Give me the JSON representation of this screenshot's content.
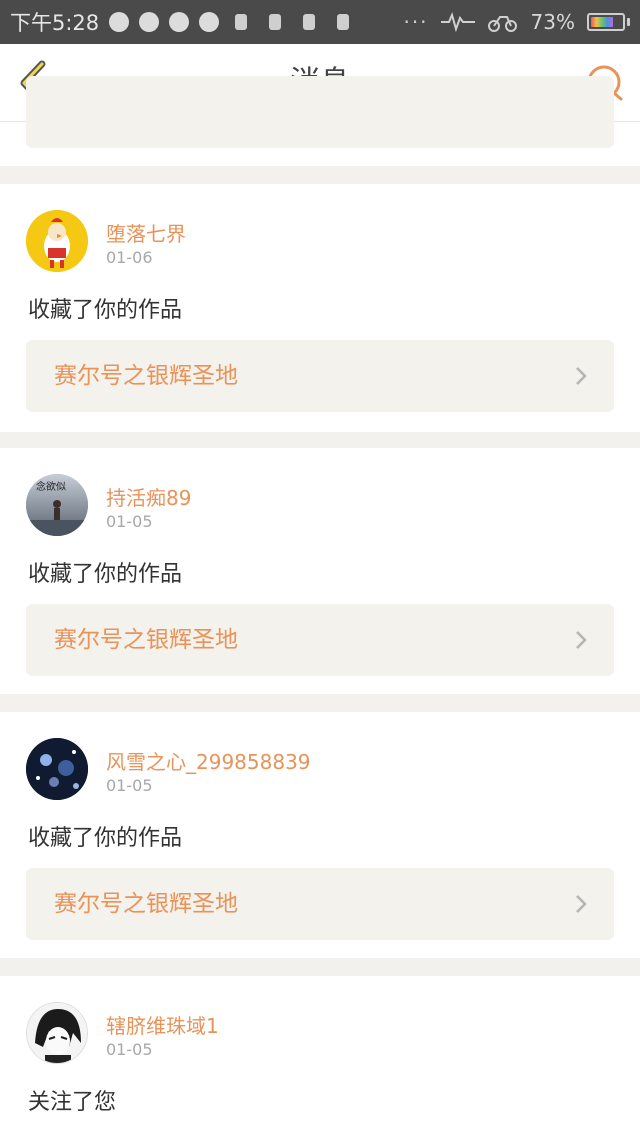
{
  "status_bar": {
    "time": "下午5:28",
    "dots": "···",
    "battery": "73%",
    "battery_level": 0.73
  },
  "header": {
    "title": "消息"
  },
  "messages": [
    {
      "username": "堕落七界",
      "date": "01-06",
      "action": "收藏了你的作品",
      "work_title": "赛尔号之银辉圣地"
    },
    {
      "username": "持活痴89",
      "date": "01-05",
      "action": "收藏了你的作品",
      "work_title": "赛尔号之银辉圣地",
      "avatar_text": "念欲似"
    },
    {
      "username": "风雪之心_299858839",
      "date": "01-05",
      "action": "收藏了你的作品",
      "work_title": "赛尔号之银辉圣地"
    },
    {
      "username": "辖脐维珠域1",
      "date": "01-05",
      "action": "关注了您"
    }
  ],
  "colors": {
    "accent": "#e8935a",
    "link_bg": "#f3f2ec",
    "page_bg": "#f2f1ee",
    "status_bg": "#4a4a4a"
  }
}
